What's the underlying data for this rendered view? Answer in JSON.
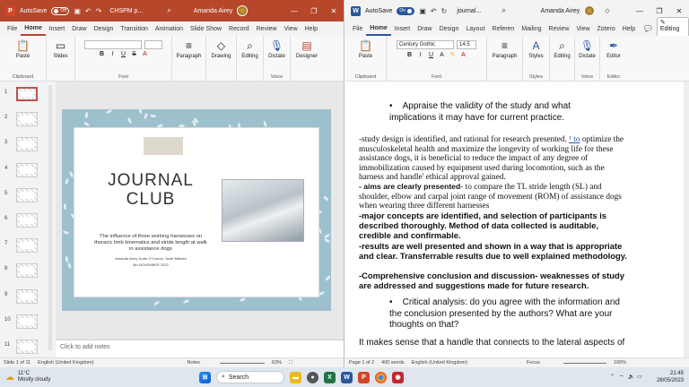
{
  "ppt": {
    "autosave": "AutoSave",
    "toggle": "Off",
    "title": "CHSPM p...",
    "user": "Amanda Airey",
    "tabs": [
      "File",
      "Home",
      "Insert",
      "Draw",
      "Design",
      "Transition",
      "Animation",
      "Slide Show",
      "Record",
      "Review",
      "View",
      "Help"
    ],
    "groups": {
      "clipboard": "Clipboard",
      "paste": "Paste",
      "slides": "Slides",
      "font": "Font",
      "paragraph": "Paragraph",
      "drawing": "Drawing",
      "editing": "Editing",
      "dictate": "Dictate",
      "voice": "Voice",
      "designer": "Designer"
    },
    "slide_numbers": [
      "1",
      "2",
      "3",
      "4",
      "5",
      "6",
      "7",
      "8",
      "9",
      "10",
      "11"
    ],
    "slide": {
      "title_line1": "JOURNAL",
      "title_line2": "CLUB",
      "subtitle": "The influence of three working harnesses on thoracic limb kinematics and stride length at walk in assistance dogs",
      "authors": "Amanda Airey, Aoife O'Connor, Jodie Mitham",
      "date": "6th NOVEMBER 2022"
    },
    "notes": "Click to add notes",
    "status": {
      "slide": "Slide 1 of 11",
      "language": "English (United Kingdom)",
      "notes": "Notes",
      "zoom": "63%"
    }
  },
  "word": {
    "autosave": "AutoSave",
    "toggle": "On",
    "title": "journal...",
    "user": "Amanda Airey",
    "tabs": [
      "File",
      "Home",
      "Insert",
      "Draw",
      "Design",
      "Layout",
      "Referen",
      "Mailing",
      "Review",
      "View",
      "Zotero",
      "Help"
    ],
    "editing_mode": "Editing",
    "font_name": "Century Gothic",
    "font_size": "14.5",
    "groups": {
      "clipboard": "Clipboard",
      "paste": "Paste",
      "font": "Font",
      "paragraph": "Paragraph",
      "styles": "Styles",
      "styles_label": "Styles",
      "editing": "Editing",
      "dictate": "Dictate",
      "voice": "Voice",
      "editor": "Editor",
      "editor_label": "Editor"
    },
    "doc": {
      "bullet1": "Appraise the validity of the study and what implications it may have for current practice.",
      "para1": "-study design is identified, and rational for research presented. ",
      "link": "¹ to",
      "para1b": "optimize the musculoskeletal health and maximize the longevity of working life for these assistance dogs, it is beneficial to reduce the impact of any degree of immobilization caused by equipment used during locomotion, such as the harness and handle' ethical approval gained.",
      "para2a": "- aims are clearly presented",
      "para2b": "- to compare the TL stride length (SL) and shoulder, elbow and carpal joint range of movement (ROM) of assistance dogs when wearing three different harnesses",
      "bold1": "-major concepts are identified, and selection of participants is described thoroughly. Method of data collected is auditable, credible and confirmable.",
      "bold2": "-results are well presented and shown in a way that is appropriate and clear. Transferrable results due to well explained methodology.",
      "bold3": "-Comprehensive conclusion and discussion- weaknesses of study are addressed and suggestions made for future research.",
      "bullet2": "Critical analysis: do you agree with the information and the conclusion presented by the authors? What are your thoughts on that?",
      "para3": "It makes sense that a handle that connects to the lateral aspects of"
    },
    "status": {
      "page": "Page 1 of 2",
      "words": "400 words",
      "language": "English (United Kingdom)",
      "focus": "Focus",
      "zoom": "100%"
    }
  },
  "taskbar": {
    "temp": "11°C",
    "weather": "Mostly cloudy",
    "search": "Search",
    "time": "21:45",
    "date": "28/05/2023"
  }
}
